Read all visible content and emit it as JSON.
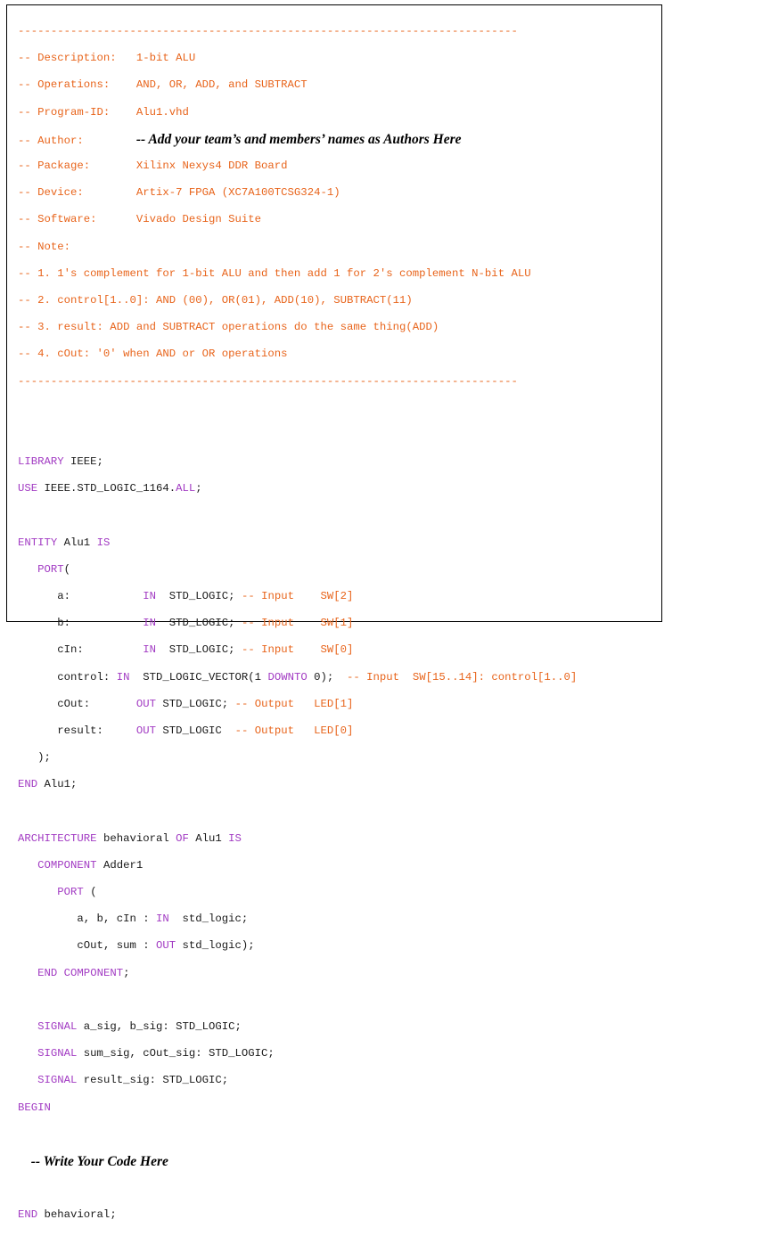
{
  "header": {
    "rule": "----------------------------------------------------------------------------",
    "desc_label": "-- Description:   ",
    "desc_value": "1-bit ALU",
    "ops_label": "-- Operations:    ",
    "ops_value": "AND, OR, ADD, and SUBTRACT",
    "pid_label": "-- Program-ID:    ",
    "pid_value": "Alu1.vhd",
    "author_label": "-- Author:        ",
    "author_value": "-- Add your team’s and members’ names as Authors Here",
    "pkg_label": "-- Package:       ",
    "pkg_value": "Xilinx Nexys4 DDR Board",
    "dev_label": "-- Device:        ",
    "dev_value": "Artix-7 FPGA (XC7A100TCSG324-1)",
    "sw_label": "-- Software:      ",
    "sw_value": "Vivado Design Suite",
    "note_label": "-- Note:",
    "note1": "-- 1. 1's complement for 1-bit ALU and then add 1 for 2's complement N-bit ALU",
    "note2": "-- 2. control[1..0]: AND (00), OR(01), ADD(10), SUBTRACT(11)",
    "note3": "-- 3. result: ADD and SUBTRACT operations do the same thing(ADD)",
    "note4": "-- 4. cOut: '0' when AND or OR operations"
  },
  "lib": {
    "library": "LIBRARY",
    "ieee": " IEEE;",
    "use": "USE",
    "pkg": " IEEE.STD_LOGIC_1164.",
    "all": "ALL",
    "semi": ";"
  },
  "entity": {
    "kw": "ENTITY",
    "name": " Alu1 ",
    "is": "IS",
    "port": "PORT",
    "a": "a:       ",
    "b": "b:       ",
    "cin": "cIn:     ",
    "control": "control: ",
    "cout": "cOut:    ",
    "result": "result:  ",
    "in": "IN",
    "out": "OUT",
    "sl": "STD_LOGIC;",
    "slv": "STD_LOGIC_VECTOR(1 ",
    "downto": "DOWNTO",
    "slv_end": " 0);",
    "sl_nosemi": "STD_LOGIC",
    "c_a": "-- Input    SW[2]",
    "c_b": "-- Input    SW[1]",
    "c_cin": "-- Input    SW[0]",
    "c_control": "-- Input  SW[15..14]: control[1..0]",
    "c_cout": "-- Output   LED[1]",
    "c_result": "-- Output   LED[0]",
    "close": ");",
    "end_kw": "END",
    "end_name": " Alu1;"
  },
  "arch": {
    "kw": "ARCHITECTURE",
    "name": " behavioral ",
    "of": "OF",
    "ent": " Alu1 ",
    "is": "IS",
    "component": "COMPONENT",
    "adder": " Adder1",
    "port": "PORT",
    "port_paren": " (",
    "ports_in": "a, b, cIn : ",
    "in": "IN",
    "in_type": "  std_logic;",
    "ports_out": "cOut, sum : ",
    "out": "OUT",
    "out_type": " std_logic);",
    "end_kw": "END",
    "end_comp": "COMPONENT",
    "semi": ";",
    "signal": "SIGNAL",
    "sig1": " a_sig, b_sig: STD_LOGIC;",
    "sig2": " sum_sig, cOut_sig: STD_LOGIC;",
    "sig3": " result_sig: STD_LOGIC;",
    "begin": "BEGIN",
    "write_note": "-- Write Your Code Here",
    "end_name": " behavioral;"
  }
}
